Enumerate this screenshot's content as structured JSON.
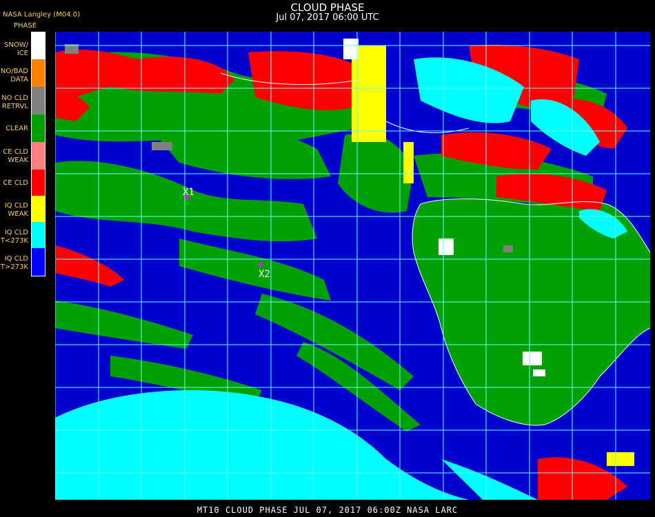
{
  "header": {
    "title": "CLOUD PHASE",
    "datetime": "Jul 07, 2017 06:00 UTC",
    "org": "NASA Langley (M04.0)"
  },
  "legend": {
    "title": "PHASE",
    "items": [
      {
        "label": "SNOW/\nICE",
        "color": "#ffffff"
      },
      {
        "label": "NO/BAD\nDATA",
        "color": "#ff8000"
      },
      {
        "label": "NO CLD\nRETRVL",
        "color": "#808080"
      },
      {
        "label": "CLEAR",
        "color": "#00a000"
      },
      {
        "label": "CE CLD\nWEAK",
        "color": "#ff8080"
      },
      {
        "label": "CE CLD",
        "color": "#ff0000"
      },
      {
        "label": "IQ CLD\nWEAK",
        "color": "#ffff00"
      },
      {
        "label": "IQ CLD\nT<273K",
        "color": "#00ffff"
      },
      {
        "label": "IQ CLD\nT>273K",
        "color": "#0000ff"
      }
    ]
  },
  "map": {
    "markers": [
      {
        "label": "X1"
      },
      {
        "label": "X2"
      }
    ],
    "grid_color": "#66ffff",
    "marker_color": "#ff00ff"
  },
  "footer": "MT10  CLOUD PHASE  JUL 07, 2017 06:00Z  NASA LARC"
}
